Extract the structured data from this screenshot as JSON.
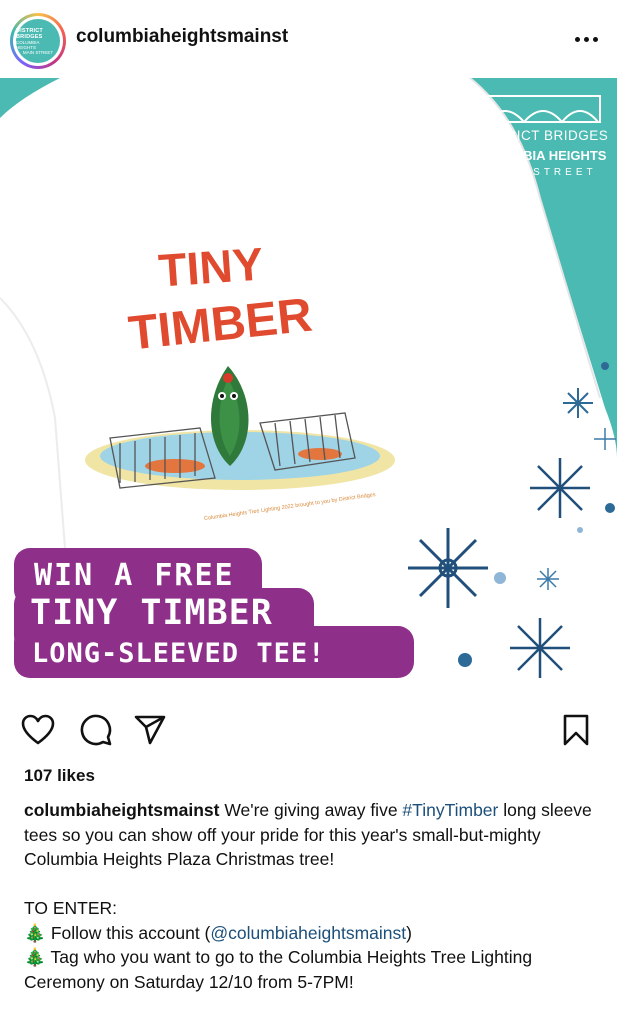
{
  "header": {
    "username": "columbiaheightsmainst",
    "avatar_line1": "DISTRICT BRIDGES",
    "avatar_line2": "COLUMBIA HEIGHTS",
    "avatar_line3": "MAIN STREET"
  },
  "image": {
    "logo_line1": "DISTRICT BRIDGES",
    "logo_line2": "COLUMBIA HEIGHTS",
    "logo_line3": "MAIN STREET",
    "design_line1": "TINY",
    "design_line2": "TIMBER",
    "design_caption": "Columbia Heights Tree Lighting 2022 brought to you by District Bridges",
    "promo_line1": "WIN A FREE",
    "promo_line2": "TINY TIMBER",
    "promo_line3": "LONG-SLEEVED TEE!",
    "colors": {
      "teal": "#4bbab2",
      "promo_purple": "#8e2f8a",
      "title_red": "#e04a2f",
      "snowflake_navy": "#1f4f7a"
    }
  },
  "likes": "107 likes",
  "caption": {
    "username": "columbiaheightsmainst",
    "text1": " We're giving away five ",
    "hashtag": "#TinyTimber",
    "text2": " long sleeve tees so you can show off your pride for this year's small-but-mighty Columbia Heights Plaza Christmas tree!",
    "to_enter": "TO ENTER:",
    "item1_pre": " Follow this account (",
    "item1_mention": "@columbiaheightsmainst",
    "item1_post": ")",
    "item2": " Tag who you want to go to the Columbia Heights Tree Lighting Ceremony on Saturday 12/10 from 5-7PM!",
    "bullet_emoji": "🎄"
  },
  "icons": [
    "heart-icon",
    "comment-icon",
    "share-icon",
    "bookmark-icon",
    "more-icon"
  ]
}
